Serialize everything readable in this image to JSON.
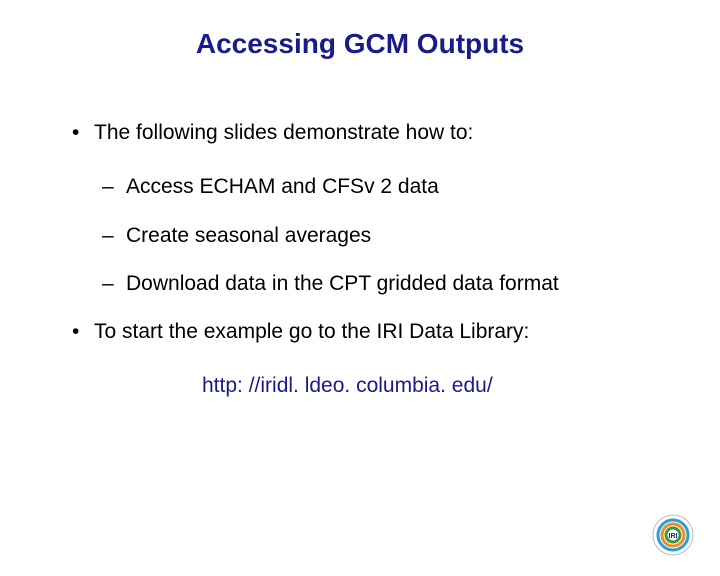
{
  "title": "Accessing GCM Outputs",
  "bullets": {
    "intro": "The following slides demonstrate how to:",
    "sub1": "Access ECHAM and CFSv 2 data",
    "sub2": "Create seasonal averages",
    "sub3": "Download data in the CPT gridded data format",
    "start": "To start the example go to the IRI Data Library:"
  },
  "url": "http: //iridl. ldeo. columbia. edu/",
  "logo_label": "IRI"
}
